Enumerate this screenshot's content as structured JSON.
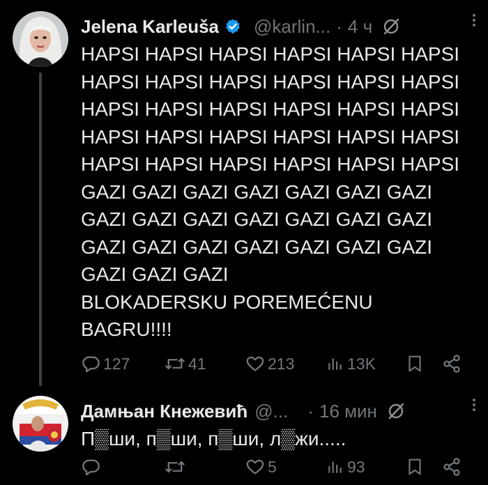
{
  "tweets": [
    {
      "author": "Jelena Karleuša",
      "handle": "@karlin...",
      "separator": "·",
      "time": "4 ч",
      "verified": true,
      "lines": [
        "HAPSI HAPSI HAPSI HAPSI HAPSI HAPSI",
        "HAPSI HAPSI HAPSI HAPSI HAPSI HAPSI",
        "HAPSI HAPSI HAPSI HAPSI HAPSI HAPSI",
        "HAPSI HAPSI HAPSI HAPSI HAPSI HAPSI",
        "HAPSI HAPSI HAPSI HAPSI HAPSI HAPSI",
        "GAZI GAZI GAZI GAZI GAZI GAZI GAZI",
        "GAZI GAZI GAZI GAZI GAZI GAZI GAZI",
        "GAZI GAZI GAZI GAZI GAZI GAZI GAZI",
        "GAZI GAZI GAZI",
        "BLOKADERSKU POREMEĆENU",
        "BAGRU!!!!"
      ],
      "stats": {
        "replies": "127",
        "reposts": "41",
        "likes": "213",
        "views": "13K"
      }
    },
    {
      "author": "Дамњан Кнежевић",
      "handle": "@...",
      "separator": "·",
      "time": "16 мин",
      "verified": false,
      "lines": [
        "П▒ши, п▒ши, п▒ши, л▒жи....."
      ],
      "stats": {
        "replies": "",
        "reposts": "",
        "likes": "5",
        "views": "93"
      }
    }
  ],
  "icons": {
    "reply": "reply-icon",
    "repost": "repost-icon",
    "like": "heart-icon",
    "views": "views-icon",
    "bookmark": "bookmark-icon",
    "share": "share-icon",
    "grok": "grok-icon",
    "more": "more-icon",
    "verified": "verified-badge-icon"
  },
  "colors": {
    "background": "#000000",
    "text": "#e7e9ea",
    "muted": "#71767b",
    "verified": "#1d9bf0",
    "thread_line": "#3e4144"
  }
}
